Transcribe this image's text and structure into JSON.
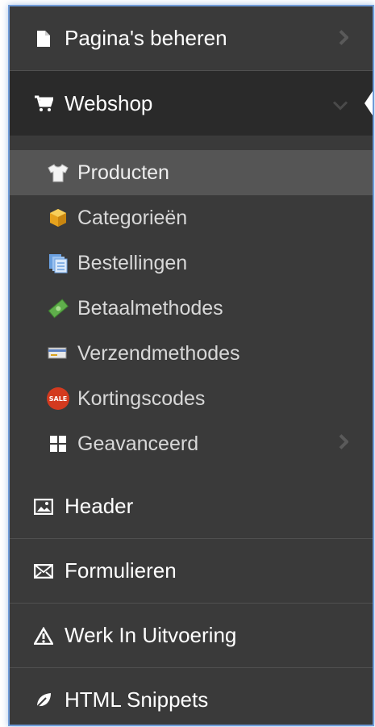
{
  "menu": {
    "items": [
      {
        "label": "Pagina's beheren",
        "icon": "page-icon",
        "has_arrow": true
      },
      {
        "label": "Webshop",
        "icon": "cart-icon",
        "expanded": true
      }
    ],
    "webshop_sub": [
      {
        "label": "Producten",
        "icon": "shirt-icon",
        "selected": true
      },
      {
        "label": "Categorieën",
        "icon": "box-icon"
      },
      {
        "label": "Bestellingen",
        "icon": "documents-icon"
      },
      {
        "label": "Betaalmethodes",
        "icon": "money-icon"
      },
      {
        "label": "Verzendmethodes",
        "icon": "shipping-card-icon"
      },
      {
        "label": "Kortingscodes",
        "icon": "sale-badge-icon",
        "badge_text": "SALE"
      },
      {
        "label": "Geavanceerd",
        "icon": "grid-icon",
        "has_arrow": true
      }
    ],
    "bottom_items": [
      {
        "label": "Header",
        "icon": "image-icon"
      },
      {
        "label": "Formulieren",
        "icon": "envelope-icon"
      },
      {
        "label": "Werk In Uitvoering",
        "icon": "warning-icon"
      },
      {
        "label": "HTML Snippets",
        "icon": "leaf-icon"
      }
    ]
  },
  "colors": {
    "sidebar_bg": "#3a3a3a",
    "active_bg": "#2a2a2a",
    "selected_bg": "#555555",
    "frame_border": "#6f9bd8"
  }
}
